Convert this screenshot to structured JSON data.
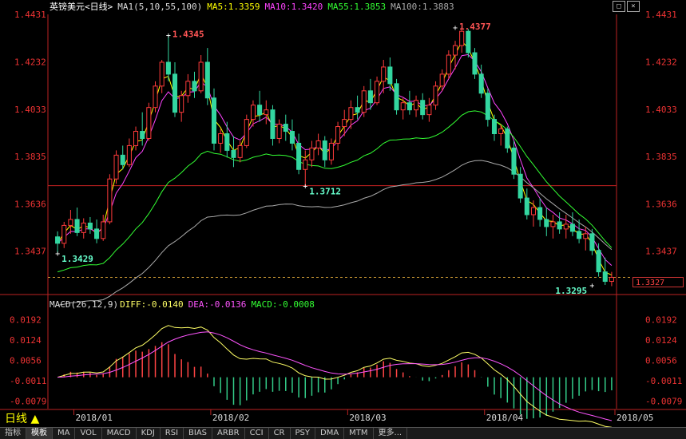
{
  "header": {
    "title": "英镑美元<日线>",
    "ma_label": "MA1(5,10,55,100)",
    "ma5": "MA5:1.3359",
    "ma10": "MA10:1.3420",
    "ma55": "MA55:1.3853",
    "ma100": "MA100:1.3883",
    "colors": {
      "title": "#ffffff",
      "ma5": "#ffff00",
      "ma10": "#ff44ff",
      "ma55": "#33ff33",
      "ma100": "#aaaaaa"
    }
  },
  "macd_header": {
    "label": "MACD(26,12,9)",
    "diff": "DIFF:-0.0140",
    "dea": "DEA:-0.0136",
    "macd": "MACD:-0.0008"
  },
  "window_buttons": [
    "□",
    "×"
  ],
  "current_price": "1.3327",
  "period_label": "日线 ▲",
  "tabs": [
    "指标",
    "模板",
    "MA",
    "VOL",
    "MACD",
    "KDJ",
    "RSI",
    "BIAS",
    "ARBR",
    "CCI",
    "CR",
    "PSY",
    "DMA",
    "MTM",
    "更多..."
  ],
  "chart_data": [
    {
      "type": "candlestick",
      "title": "英镑美元<日线>",
      "ylim": [
        1.3285,
        1.4431
      ],
      "y_ticks": [
        "1.4431",
        "1.4232",
        "1.4033",
        "1.3835",
        "1.3636",
        "1.3437"
      ],
      "x_ticks": [
        "2018/01",
        "2018/02",
        "2018/03",
        "2018/04",
        "2018/05"
      ],
      "annotations": [
        {
          "text": "1.4345",
          "value": 1.4345
        },
        {
          "text": "1.4377",
          "value": 1.4377
        },
        {
          "text": "1.3712",
          "value": 1.3712
        },
        {
          "text": "1.3429",
          "value": 1.3429
        },
        {
          "text": "1.3295",
          "value": 1.3295
        }
      ],
      "reference_line": 1.3712,
      "current_price_line": 1.3327,
      "ohlc": [
        [
          1.3497,
          1.352,
          1.3429,
          1.347
        ],
        [
          1.347,
          1.356,
          1.345,
          1.3545
        ],
        [
          1.3545,
          1.361,
          1.351,
          1.357
        ],
        [
          1.357,
          1.362,
          1.35,
          1.3515
        ],
        [
          1.3515,
          1.3575,
          1.349,
          1.3555
        ],
        [
          1.3555,
          1.358,
          1.351,
          1.353
        ],
        [
          1.353,
          1.357,
          1.347,
          1.349
        ],
        [
          1.349,
          1.359,
          1.348,
          1.356
        ],
        [
          1.356,
          1.376,
          1.355,
          1.374
        ],
        [
          1.374,
          1.386,
          1.372,
          1.384
        ],
        [
          1.384,
          1.388,
          1.378,
          1.38
        ],
        [
          1.38,
          1.391,
          1.379,
          1.388
        ],
        [
          1.388,
          1.396,
          1.386,
          1.394
        ],
        [
          1.394,
          1.402,
          1.388,
          1.391
        ],
        [
          1.391,
          1.406,
          1.39,
          1.404
        ],
        [
          1.404,
          1.415,
          1.402,
          1.413
        ],
        [
          1.413,
          1.424,
          1.41,
          1.423
        ],
        [
          1.423,
          1.4345,
          1.415,
          1.418
        ],
        [
          1.418,
          1.423,
          1.4,
          1.402
        ],
        [
          1.402,
          1.411,
          1.398,
          1.409
        ],
        [
          1.409,
          1.418,
          1.406,
          1.415
        ],
        [
          1.415,
          1.419,
          1.408,
          1.411
        ],
        [
          1.411,
          1.426,
          1.41,
          1.423
        ],
        [
          1.423,
          1.429,
          1.405,
          1.408
        ],
        [
          1.408,
          1.412,
          1.386,
          1.389
        ],
        [
          1.389,
          1.395,
          1.385,
          1.393
        ],
        [
          1.393,
          1.398,
          1.383,
          1.386
        ],
        [
          1.386,
          1.392,
          1.379,
          1.383
        ],
        [
          1.383,
          1.39,
          1.381,
          1.388
        ],
        [
          1.388,
          1.401,
          1.387,
          1.399
        ],
        [
          1.399,
          1.407,
          1.396,
          1.405
        ],
        [
          1.405,
          1.411,
          1.398,
          1.401
        ],
        [
          1.401,
          1.407,
          1.397,
          1.403
        ],
        [
          1.403,
          1.405,
          1.388,
          1.391
        ],
        [
          1.391,
          1.399,
          1.389,
          1.397
        ],
        [
          1.397,
          1.401,
          1.39,
          1.394
        ],
        [
          1.394,
          1.399,
          1.386,
          1.389
        ],
        [
          1.389,
          1.393,
          1.376,
          1.378
        ],
        [
          1.378,
          1.386,
          1.3712,
          1.382
        ],
        [
          1.382,
          1.39,
          1.379,
          1.387
        ],
        [
          1.387,
          1.393,
          1.384,
          1.39
        ],
        [
          1.39,
          1.392,
          1.379,
          1.382
        ],
        [
          1.382,
          1.391,
          1.38,
          1.389
        ],
        [
          1.389,
          1.398,
          1.386,
          1.396
        ],
        [
          1.396,
          1.403,
          1.392,
          1.399
        ],
        [
          1.399,
          1.407,
          1.395,
          1.404
        ],
        [
          1.404,
          1.409,
          1.399,
          1.402
        ],
        [
          1.402,
          1.413,
          1.4,
          1.411
        ],
        [
          1.411,
          1.416,
          1.403,
          1.406
        ],
        [
          1.406,
          1.417,
          1.405,
          1.415
        ],
        [
          1.415,
          1.424,
          1.41,
          1.421
        ],
        [
          1.421,
          1.425,
          1.411,
          1.414
        ],
        [
          1.414,
          1.416,
          1.401,
          1.403
        ],
        [
          1.403,
          1.408,
          1.399,
          1.406
        ],
        [
          1.406,
          1.411,
          1.401,
          1.403
        ],
        [
          1.403,
          1.409,
          1.4,
          1.407
        ],
        [
          1.407,
          1.41,
          1.399,
          1.401
        ],
        [
          1.401,
          1.408,
          1.398,
          1.405
        ],
        [
          1.405,
          1.415,
          1.403,
          1.413
        ],
        [
          1.413,
          1.42,
          1.411,
          1.418
        ],
        [
          1.418,
          1.428,
          1.416,
          1.426
        ],
        [
          1.426,
          1.432,
          1.42,
          1.43
        ],
        [
          1.43,
          1.4377,
          1.427,
          1.436
        ],
        [
          1.436,
          1.437,
          1.425,
          1.427
        ],
        [
          1.427,
          1.429,
          1.416,
          1.418
        ],
        [
          1.418,
          1.422,
          1.408,
          1.41
        ],
        [
          1.41,
          1.412,
          1.396,
          1.399
        ],
        [
          1.399,
          1.401,
          1.39,
          1.393
        ],
        [
          1.393,
          1.397,
          1.388,
          1.395
        ],
        [
          1.395,
          1.396,
          1.385,
          1.387
        ],
        [
          1.387,
          1.39,
          1.374,
          1.376
        ],
        [
          1.376,
          1.379,
          1.364,
          1.366
        ],
        [
          1.366,
          1.37,
          1.357,
          1.359
        ],
        [
          1.359,
          1.365,
          1.354,
          1.362
        ],
        [
          1.362,
          1.366,
          1.354,
          1.357
        ],
        [
          1.357,
          1.362,
          1.35,
          1.354
        ],
        [
          1.354,
          1.359,
          1.349,
          1.356
        ],
        [
          1.356,
          1.36,
          1.351,
          1.353
        ],
        [
          1.353,
          1.359,
          1.349,
          1.355
        ],
        [
          1.355,
          1.36,
          1.35,
          1.352
        ],
        [
          1.352,
          1.357,
          1.347,
          1.349
        ],
        [
          1.349,
          1.354,
          1.344,
          1.351
        ],
        [
          1.351,
          1.353,
          1.342,
          1.344
        ],
        [
          1.344,
          1.347,
          1.333,
          1.335
        ],
        [
          1.335,
          1.341,
          1.3295,
          1.331
        ],
        [
          1.331,
          1.335,
          1.329,
          1.3327
        ]
      ],
      "series": [
        {
          "name": "MA5",
          "color": "#ffff00"
        },
        {
          "name": "MA10",
          "color": "#ff44ff"
        },
        {
          "name": "MA55",
          "color": "#33ff33"
        },
        {
          "name": "MA100",
          "color": "#aaaaaa"
        }
      ]
    },
    {
      "type": "bar+line",
      "title": "MACD(26,12,9)",
      "ylim": [
        -0.0105,
        0.0215
      ],
      "y_ticks": [
        "0.0192",
        "0.0124",
        "0.0056",
        "-0.0011",
        "-0.0079"
      ],
      "series": [
        {
          "name": "DIFF",
          "color": "#ffff66",
          "last": -0.014
        },
        {
          "name": "DEA",
          "color": "#ff55ff",
          "last": -0.0136
        },
        {
          "name": "MACD",
          "color": "#ff4444",
          "last": -0.0008
        }
      ]
    }
  ]
}
